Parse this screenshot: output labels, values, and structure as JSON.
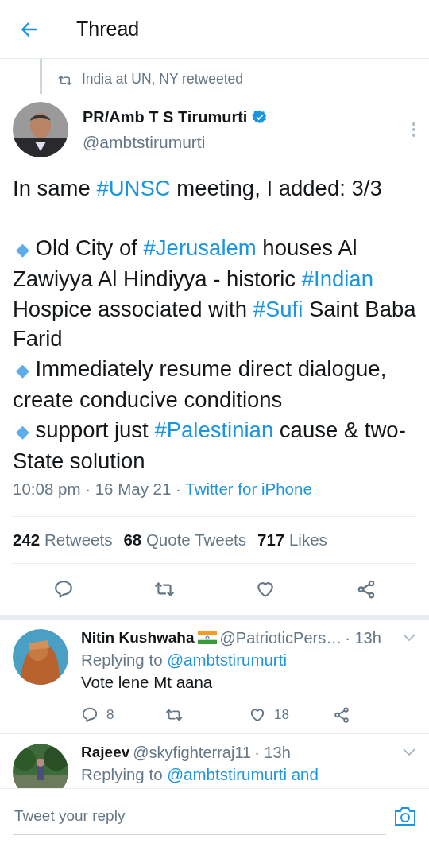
{
  "header": {
    "title": "Thread"
  },
  "tweet": {
    "social_context": "India at UN, NY retweeted",
    "name": "PR/Amb T S Tirumurti",
    "verified": true,
    "handle": "@ambtstirumurti",
    "intro": [
      {
        "kind": "text",
        "text": "In same "
      },
      {
        "kind": "hashtag",
        "text": "#UNSC"
      },
      {
        "kind": "text",
        "text": " meeting, I added: 3/3"
      }
    ],
    "bullets": [
      [
        {
          "kind": "bullet",
          "text": "◆"
        },
        {
          "kind": "text",
          "text": " Old City of "
        },
        {
          "kind": "hashtag",
          "text": "#Jerusalem"
        },
        {
          "kind": "text",
          "text": " houses Al Zawiyya Al Hindiyya - historic "
        },
        {
          "kind": "hashtag",
          "text": "#Indian"
        },
        {
          "kind": "text",
          "text": " Hospice associated with "
        },
        {
          "kind": "hashtag",
          "text": "#Sufi"
        },
        {
          "kind": "text",
          "text": " Saint Baba Farid"
        }
      ],
      [
        {
          "kind": "bullet",
          "text": "◆"
        },
        {
          "kind": "text",
          "text": " Immediately resume direct dialogue, create conducive conditions"
        }
      ],
      [
        {
          "kind": "bullet",
          "text": "◆"
        },
        {
          "kind": "text",
          "text": " support just "
        },
        {
          "kind": "hashtag",
          "text": "#Palestinian"
        },
        {
          "kind": "text",
          "text": " cause & two-State solution"
        }
      ]
    ],
    "time": "10:08 pm · 16 May 21 · ",
    "source": "Twitter for iPhone",
    "stats": [
      {
        "count": "242",
        "label": "Retweets"
      },
      {
        "count": "68",
        "label": "Quote Tweets"
      },
      {
        "count": "717",
        "label": "Likes"
      }
    ]
  },
  "replies": [
    {
      "name": "Nitin Kushwaha",
      "flag": true,
      "handle": "@PatrioticPers…",
      "time": "· 13h",
      "replying_to": "Replying to ",
      "mention": "@ambtstirumurti",
      "text": "Vote lene Mt aana",
      "reply_count": "8",
      "like_count": "18"
    },
    {
      "name": "Rajeev",
      "flag": false,
      "handle": "@skyfighterraj11",
      "time": "· 13h",
      "replying_to": "Replying to ",
      "mention": "@ambtstirumurti and"
    }
  ],
  "composer": {
    "placeholder": "Tweet your reply"
  }
}
